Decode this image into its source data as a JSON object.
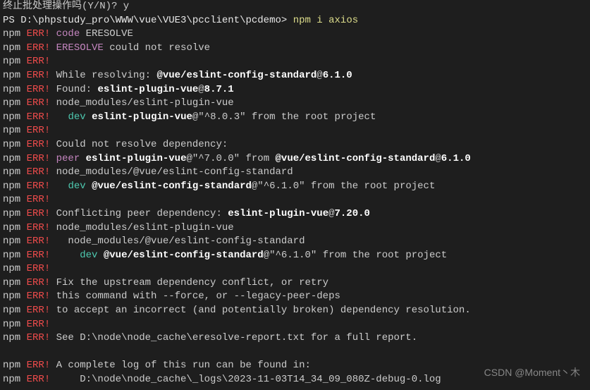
{
  "partialTop": "终止批处理操作吗(Y/N)? y",
  "prompt": {
    "ps": "PS ",
    "path": "D:\\phpstudy_pro\\WWW\\vue\\VUE3\\pcclient\\pcdemo",
    "sep": "> ",
    "cmd": "npm i axios"
  },
  "l": {
    "npm": "npm ",
    "err": "ERR!",
    "code": " code ",
    "eresolve1": "ERESOLVE",
    "eresolve2": " ERESOLVE",
    "couldNotResolve": " could not resolve",
    "whileResolving": " While resolving: ",
    "pkg1": "@vue/eslint-config-standard",
    "at1": "@",
    "v610": "6.1.0",
    "found": " Found: ",
    "pkg2": "eslint-plugin-vue",
    "at2": "@",
    "v871": "8.7.1",
    "nm1": " node_modules/eslint-plugin-vue",
    "dev": "dev",
    "indent1": "   ",
    "sp": " ",
    "pkg3": "eslint-plugin-vue",
    "range803": "@\"^8.0.3\"",
    "fromRoot": " from the root project",
    "couldNotDep": " Could not resolve dependency:",
    "peer": " peer ",
    "pkg4": "eslint-plugin-vue",
    "range700": "@\"^7.0.0\"",
    "from": " from ",
    "pkg5": "@vue/eslint-config-standard",
    "at3": "@",
    "nm2": " node_modules/@vue/eslint-config-standard",
    "pkg6": "@vue/eslint-config-standard",
    "range610": "@\"^6.1.0\"",
    "conflict": " Conflicting peer dependency: ",
    "pkg7": "eslint-plugin-vue",
    "at4": "@",
    "v7200": "7.20.0",
    "nm3": " node_modules/eslint-plugin-vue",
    "nm4": "   node_modules/@vue/eslint-config-standard",
    "indent2": "     ",
    "pkg8": "@vue/eslint-config-standard",
    "fix1": " Fix the upstream dependency conflict, or retry",
    "fix2": " this command with --force, or --legacy-peer-deps",
    "fix3": " to accept an incorrect (and potentially broken) dependency resolution.",
    "see": " See D:\\node\\node_cache\\eresolve-report.txt for a full report.",
    "log1": " A complete log of this run can be found in:",
    "log2": "     D:\\node\\node_cache\\_logs\\2023-11-03T14_34_09_080Z-debug-0.log"
  },
  "watermark": "CSDN @Moment丶木"
}
